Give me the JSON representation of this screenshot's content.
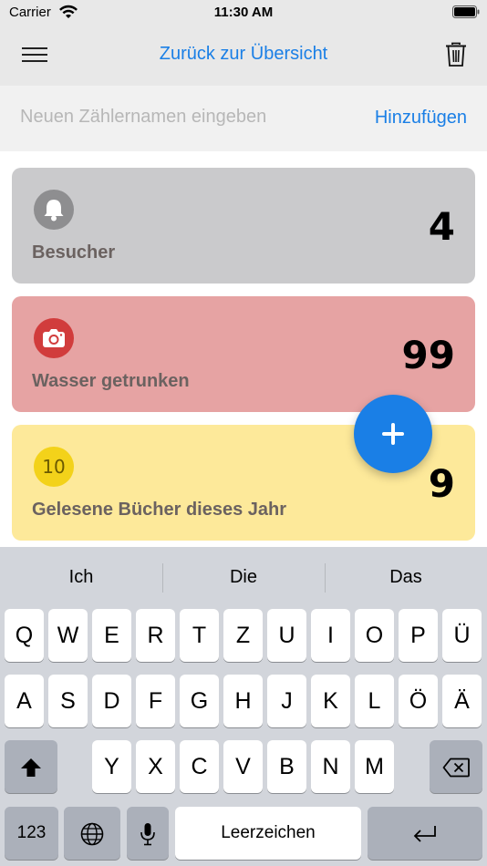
{
  "status_bar": {
    "carrier": "Carrier",
    "time": "11:30 AM"
  },
  "nav": {
    "title": "Zurück zur Übersicht"
  },
  "new_counter": {
    "placeholder": "Neuen Zählernamen eingeben",
    "add_label": "Hinzufügen"
  },
  "counters": [
    {
      "name": "Besucher",
      "value": "4",
      "icon": "bell-icon",
      "color": "#cacacc"
    },
    {
      "name": "Wasser getrunken",
      "value": "99",
      "icon": "camera-icon",
      "color": "#e6a3a3"
    },
    {
      "name": "Gelesene Bücher dieses Jahr",
      "value": "9",
      "icon": "number-badge-icon",
      "badge_text": "10",
      "color": "#fde99a"
    }
  ],
  "keyboard": {
    "suggestions": [
      "Ich",
      "Die",
      "Das"
    ],
    "row1": [
      "Q",
      "W",
      "E",
      "R",
      "T",
      "Z",
      "U",
      "I",
      "O",
      "P",
      "Ü"
    ],
    "row2": [
      "A",
      "S",
      "D",
      "F",
      "G",
      "H",
      "J",
      "K",
      "L",
      "Ö",
      "Ä"
    ],
    "row3": [
      "Y",
      "X",
      "C",
      "V",
      "B",
      "N",
      "M"
    ],
    "numbers_label": "123",
    "space_label": "Leerzeichen"
  },
  "colors": {
    "accent": "#1a7fe6"
  }
}
